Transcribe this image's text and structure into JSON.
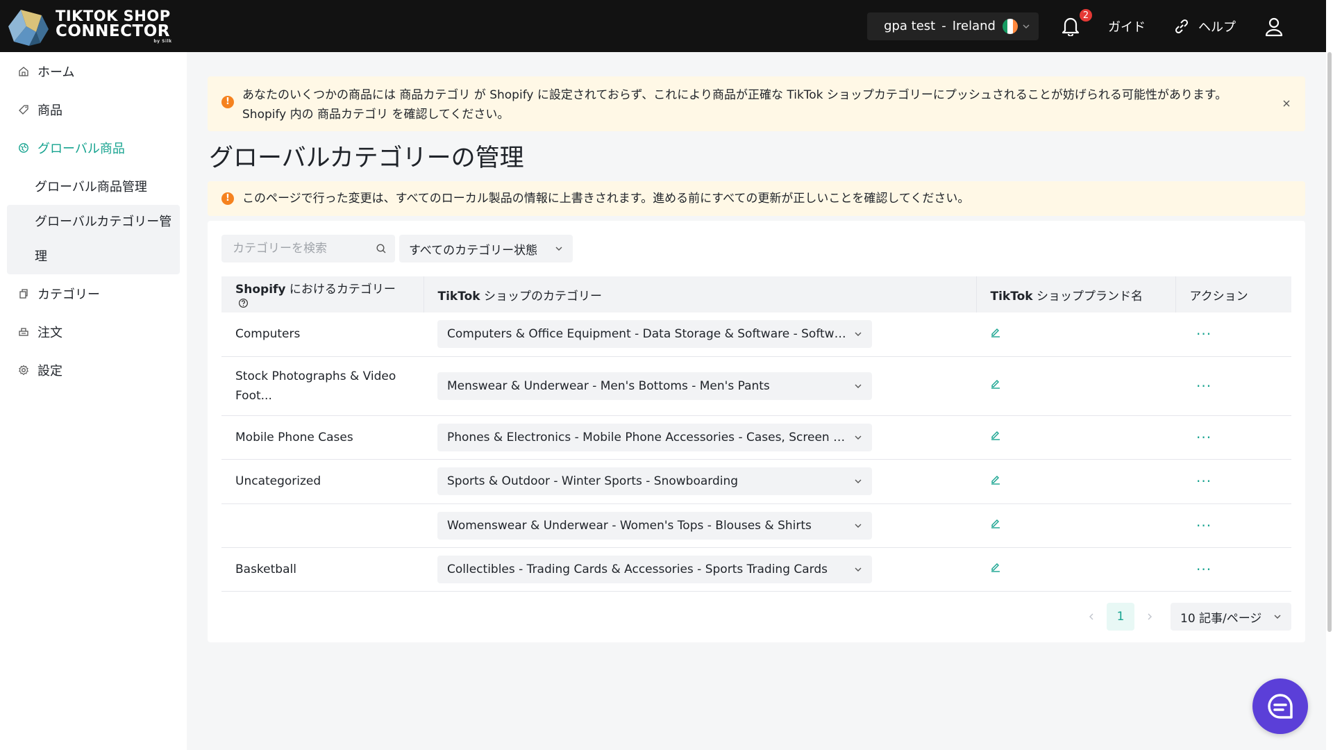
{
  "brand": {
    "line1": "TIKTOK SHOP",
    "line2": "CONNECTOR",
    "line3": "by Silk"
  },
  "header": {
    "store_name": "gpa test",
    "store_sep": "-",
    "store_country": "Ireland",
    "notifications_count": "2",
    "guide_label": "ガイド",
    "help_label": "ヘルプ"
  },
  "sidebar": {
    "items": [
      {
        "label": "ホーム",
        "icon": "home-icon"
      },
      {
        "label": "商品",
        "icon": "tag-icon"
      },
      {
        "label": "グローバル商品",
        "icon": "globe-icon",
        "active": true
      },
      {
        "label": "カテゴリー",
        "icon": "copy-icon"
      },
      {
        "label": "注文",
        "icon": "printer-icon"
      },
      {
        "label": "設定",
        "icon": "gear-icon"
      }
    ],
    "sub_items": [
      {
        "label": "グローバル商品管理"
      },
      {
        "label_line1": "グローバルカテゴリー管",
        "label_line2": "理",
        "selected": true
      }
    ]
  },
  "alerts": {
    "top": {
      "line1": "あなたのいくつかの商品には 商品カテゴリ が Shopify に設定されておらず、これにより商品が正確な TikTok ショップカテゴリーにプッシュされることが妨げられる可能性があります。",
      "line2": "Shopify 内の 商品カテゴリ を確認してください。"
    },
    "page": "このページで行った変更は、すべてのローカル製品の情報に上書きされます。進める前にすべての更新が正しいことを確認してください。"
  },
  "page_title": "グローバルカテゴリーの管理",
  "filters": {
    "search_placeholder": "カテゴリーを検索",
    "status_label": "すべてのカテゴリー状態"
  },
  "table": {
    "headers": {
      "shopify_bold": "Shopify",
      "shopify_rest": " におけるカテゴリー",
      "tiktok_bold": "TikTok",
      "tiktok_rest": " ショップのカテゴリー",
      "brand_bold": "TikTok",
      "brand_rest": " ショッププランド名",
      "action": "アクション"
    },
    "rows": [
      {
        "shopify": "Computers",
        "tiktok": "Computers & Office Equipment - Data Storage & Software - Software"
      },
      {
        "shopify_line1": "Stock Photographs & Video",
        "shopify_line2": "Foot...",
        "tiktok": "Menswear & Underwear - Men's Bottoms - Men's Pants"
      },
      {
        "shopify": "Mobile Phone Cases",
        "tiktok": "Phones & Electronics - Mobile Phone Accessories - Cases, Screen Protect..."
      },
      {
        "shopify": "Uncategorized",
        "tiktok": "Sports & Outdoor - Winter Sports - Snowboarding"
      },
      {
        "shopify": "",
        "tiktok": "Womenswear & Underwear - Women's Tops - Blouses & Shirts"
      },
      {
        "shopify": "Basketball",
        "tiktok": "Collectibles - Trading Cards & Accessories - Sports Trading Cards"
      }
    ],
    "more_label": "···"
  },
  "pagination": {
    "current_page": "1",
    "page_size": "10 記事/ページ"
  },
  "colors": {
    "accent": "#16a38f",
    "warning": "#f5821f",
    "chat": "#5b3fd8",
    "topbar": "#121212"
  }
}
